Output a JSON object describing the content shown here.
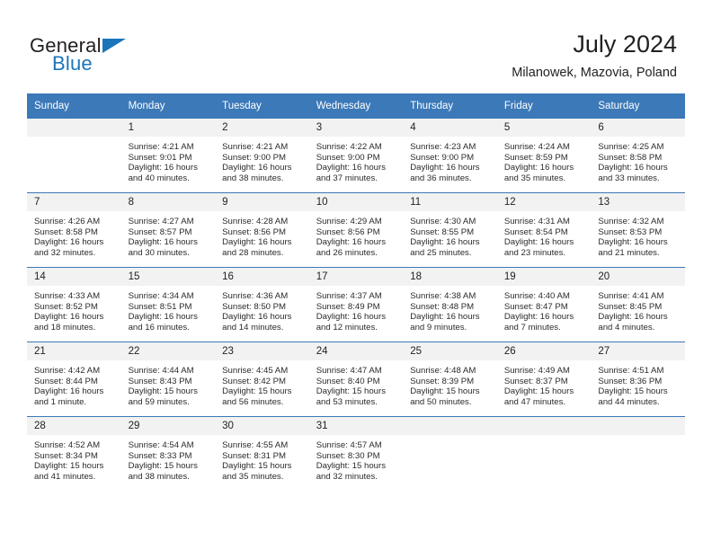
{
  "logo": {
    "text_primary": "General",
    "text_secondary": "Blue",
    "color_primary": "#231f20",
    "color_secondary": "#1b75bb"
  },
  "header": {
    "title": "July 2024",
    "subtitle": "Milanowek, Mazovia, Poland"
  },
  "theme": {
    "header_bg": "#3b79b8",
    "daynum_bg": "#f2f2f2",
    "text": "#2b2b2b"
  },
  "weekday_headers": [
    "Sunday",
    "Monday",
    "Tuesday",
    "Wednesday",
    "Thursday",
    "Friday",
    "Saturday"
  ],
  "weeks": [
    [
      {
        "day": "",
        "empty": true
      },
      {
        "day": "1",
        "sunrise": "Sunrise: 4:21 AM",
        "sunset": "Sunset: 9:01 PM",
        "daylight_1": "Daylight: 16 hours",
        "daylight_2": "and 40 minutes."
      },
      {
        "day": "2",
        "sunrise": "Sunrise: 4:21 AM",
        "sunset": "Sunset: 9:00 PM",
        "daylight_1": "Daylight: 16 hours",
        "daylight_2": "and 38 minutes."
      },
      {
        "day": "3",
        "sunrise": "Sunrise: 4:22 AM",
        "sunset": "Sunset: 9:00 PM",
        "daylight_1": "Daylight: 16 hours",
        "daylight_2": "and 37 minutes."
      },
      {
        "day": "4",
        "sunrise": "Sunrise: 4:23 AM",
        "sunset": "Sunset: 9:00 PM",
        "daylight_1": "Daylight: 16 hours",
        "daylight_2": "and 36 minutes."
      },
      {
        "day": "5",
        "sunrise": "Sunrise: 4:24 AM",
        "sunset": "Sunset: 8:59 PM",
        "daylight_1": "Daylight: 16 hours",
        "daylight_2": "and 35 minutes."
      },
      {
        "day": "6",
        "sunrise": "Sunrise: 4:25 AM",
        "sunset": "Sunset: 8:58 PM",
        "daylight_1": "Daylight: 16 hours",
        "daylight_2": "and 33 minutes."
      }
    ],
    [
      {
        "day": "7",
        "sunrise": "Sunrise: 4:26 AM",
        "sunset": "Sunset: 8:58 PM",
        "daylight_1": "Daylight: 16 hours",
        "daylight_2": "and 32 minutes."
      },
      {
        "day": "8",
        "sunrise": "Sunrise: 4:27 AM",
        "sunset": "Sunset: 8:57 PM",
        "daylight_1": "Daylight: 16 hours",
        "daylight_2": "and 30 minutes."
      },
      {
        "day": "9",
        "sunrise": "Sunrise: 4:28 AM",
        "sunset": "Sunset: 8:56 PM",
        "daylight_1": "Daylight: 16 hours",
        "daylight_2": "and 28 minutes."
      },
      {
        "day": "10",
        "sunrise": "Sunrise: 4:29 AM",
        "sunset": "Sunset: 8:56 PM",
        "daylight_1": "Daylight: 16 hours",
        "daylight_2": "and 26 minutes."
      },
      {
        "day": "11",
        "sunrise": "Sunrise: 4:30 AM",
        "sunset": "Sunset: 8:55 PM",
        "daylight_1": "Daylight: 16 hours",
        "daylight_2": "and 25 minutes."
      },
      {
        "day": "12",
        "sunrise": "Sunrise: 4:31 AM",
        "sunset": "Sunset: 8:54 PM",
        "daylight_1": "Daylight: 16 hours",
        "daylight_2": "and 23 minutes."
      },
      {
        "day": "13",
        "sunrise": "Sunrise: 4:32 AM",
        "sunset": "Sunset: 8:53 PM",
        "daylight_1": "Daylight: 16 hours",
        "daylight_2": "and 21 minutes."
      }
    ],
    [
      {
        "day": "14",
        "sunrise": "Sunrise: 4:33 AM",
        "sunset": "Sunset: 8:52 PM",
        "daylight_1": "Daylight: 16 hours",
        "daylight_2": "and 18 minutes."
      },
      {
        "day": "15",
        "sunrise": "Sunrise: 4:34 AM",
        "sunset": "Sunset: 8:51 PM",
        "daylight_1": "Daylight: 16 hours",
        "daylight_2": "and 16 minutes."
      },
      {
        "day": "16",
        "sunrise": "Sunrise: 4:36 AM",
        "sunset": "Sunset: 8:50 PM",
        "daylight_1": "Daylight: 16 hours",
        "daylight_2": "and 14 minutes."
      },
      {
        "day": "17",
        "sunrise": "Sunrise: 4:37 AM",
        "sunset": "Sunset: 8:49 PM",
        "daylight_1": "Daylight: 16 hours",
        "daylight_2": "and 12 minutes."
      },
      {
        "day": "18",
        "sunrise": "Sunrise: 4:38 AM",
        "sunset": "Sunset: 8:48 PM",
        "daylight_1": "Daylight: 16 hours",
        "daylight_2": "and 9 minutes."
      },
      {
        "day": "19",
        "sunrise": "Sunrise: 4:40 AM",
        "sunset": "Sunset: 8:47 PM",
        "daylight_1": "Daylight: 16 hours",
        "daylight_2": "and 7 minutes."
      },
      {
        "day": "20",
        "sunrise": "Sunrise: 4:41 AM",
        "sunset": "Sunset: 8:45 PM",
        "daylight_1": "Daylight: 16 hours",
        "daylight_2": "and 4 minutes."
      }
    ],
    [
      {
        "day": "21",
        "sunrise": "Sunrise: 4:42 AM",
        "sunset": "Sunset: 8:44 PM",
        "daylight_1": "Daylight: 16 hours",
        "daylight_2": "and 1 minute."
      },
      {
        "day": "22",
        "sunrise": "Sunrise: 4:44 AM",
        "sunset": "Sunset: 8:43 PM",
        "daylight_1": "Daylight: 15 hours",
        "daylight_2": "and 59 minutes."
      },
      {
        "day": "23",
        "sunrise": "Sunrise: 4:45 AM",
        "sunset": "Sunset: 8:42 PM",
        "daylight_1": "Daylight: 15 hours",
        "daylight_2": "and 56 minutes."
      },
      {
        "day": "24",
        "sunrise": "Sunrise: 4:47 AM",
        "sunset": "Sunset: 8:40 PM",
        "daylight_1": "Daylight: 15 hours",
        "daylight_2": "and 53 minutes."
      },
      {
        "day": "25",
        "sunrise": "Sunrise: 4:48 AM",
        "sunset": "Sunset: 8:39 PM",
        "daylight_1": "Daylight: 15 hours",
        "daylight_2": "and 50 minutes."
      },
      {
        "day": "26",
        "sunrise": "Sunrise: 4:49 AM",
        "sunset": "Sunset: 8:37 PM",
        "daylight_1": "Daylight: 15 hours",
        "daylight_2": "and 47 minutes."
      },
      {
        "day": "27",
        "sunrise": "Sunrise: 4:51 AM",
        "sunset": "Sunset: 8:36 PM",
        "daylight_1": "Daylight: 15 hours",
        "daylight_2": "and 44 minutes."
      }
    ],
    [
      {
        "day": "28",
        "sunrise": "Sunrise: 4:52 AM",
        "sunset": "Sunset: 8:34 PM",
        "daylight_1": "Daylight: 15 hours",
        "daylight_2": "and 41 minutes."
      },
      {
        "day": "29",
        "sunrise": "Sunrise: 4:54 AM",
        "sunset": "Sunset: 8:33 PM",
        "daylight_1": "Daylight: 15 hours",
        "daylight_2": "and 38 minutes."
      },
      {
        "day": "30",
        "sunrise": "Sunrise: 4:55 AM",
        "sunset": "Sunset: 8:31 PM",
        "daylight_1": "Daylight: 15 hours",
        "daylight_2": "and 35 minutes."
      },
      {
        "day": "31",
        "sunrise": "Sunrise: 4:57 AM",
        "sunset": "Sunset: 8:30 PM",
        "daylight_1": "Daylight: 15 hours",
        "daylight_2": "and 32 minutes."
      },
      {
        "day": "",
        "empty": true
      },
      {
        "day": "",
        "empty": true
      },
      {
        "day": "",
        "empty": true
      }
    ]
  ]
}
